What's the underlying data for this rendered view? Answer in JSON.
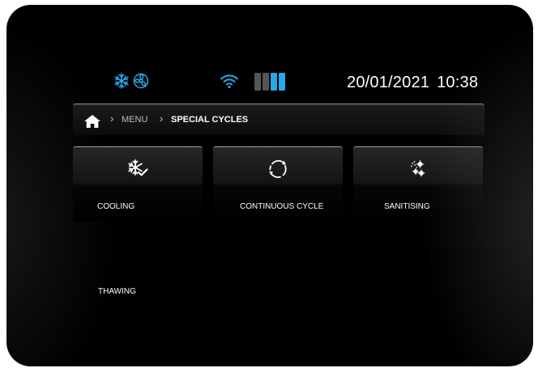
{
  "status": {
    "date": "20/01/2021",
    "time": "10:38",
    "mode_icons": [
      "snowflake-icon",
      "fan-icon"
    ],
    "wifi_icon": "wifi-icon",
    "signal_bars_active": 2,
    "signal_bars_total": 3,
    "accent_color": "#2aa7e6",
    "inactive_color": "#555555"
  },
  "breadcrumb": {
    "home_icon": "home-icon",
    "items": [
      "MENU",
      "SPECIAL CYCLES"
    ]
  },
  "tiles": [
    {
      "label": "COOLING",
      "icon": "snowflake-check-icon"
    },
    {
      "label": "CONTINUOUS CYCLE",
      "icon": "cycle-arrows-icon"
    },
    {
      "label": "SANITISING",
      "icon": "sanitising-icon"
    }
  ],
  "extra_tiles": [
    {
      "label": "THAWING"
    }
  ]
}
